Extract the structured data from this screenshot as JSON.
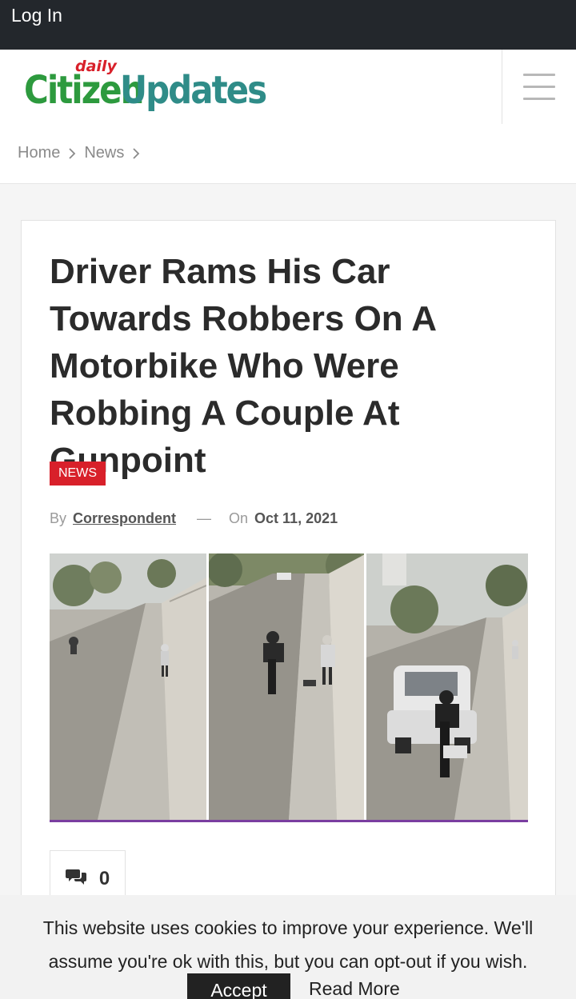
{
  "topbar": {
    "login_label": "Log In"
  },
  "header": {
    "logo": {
      "daily": "daily",
      "citizen": "Citizen",
      "updates": "Updates"
    },
    "menu_icon": "hamburger-menu-icon"
  },
  "breadcrumb": {
    "items": [
      {
        "label": "Home"
      },
      {
        "label": "News"
      }
    ],
    "separator_icon": "chevron-right-icon"
  },
  "article": {
    "title": "Driver Rams His Car Towards Robbers On A Motorbike Who Were Robbing A Couple At Gunpoint",
    "category": "NEWS",
    "meta": {
      "by_label": "By",
      "author": "Correspondent",
      "dash": "—",
      "on_label": "On",
      "date": "Oct 11, 2021"
    },
    "comments": {
      "icon": "comments-icon",
      "count": "0"
    }
  },
  "cookie_notice": {
    "message": "This website uses cookies to improve your experience. We'll assume you're ok with this, but you can opt-out if you wish.",
    "accept_label": "Accept",
    "read_more_label": "Read More"
  },
  "colors": {
    "topbar_bg": "#23272c",
    "category_badge": "#d8202a",
    "logo_green": "#2d9a3e",
    "logo_red": "#d8202a",
    "image_underline": "#7a3ea0"
  }
}
